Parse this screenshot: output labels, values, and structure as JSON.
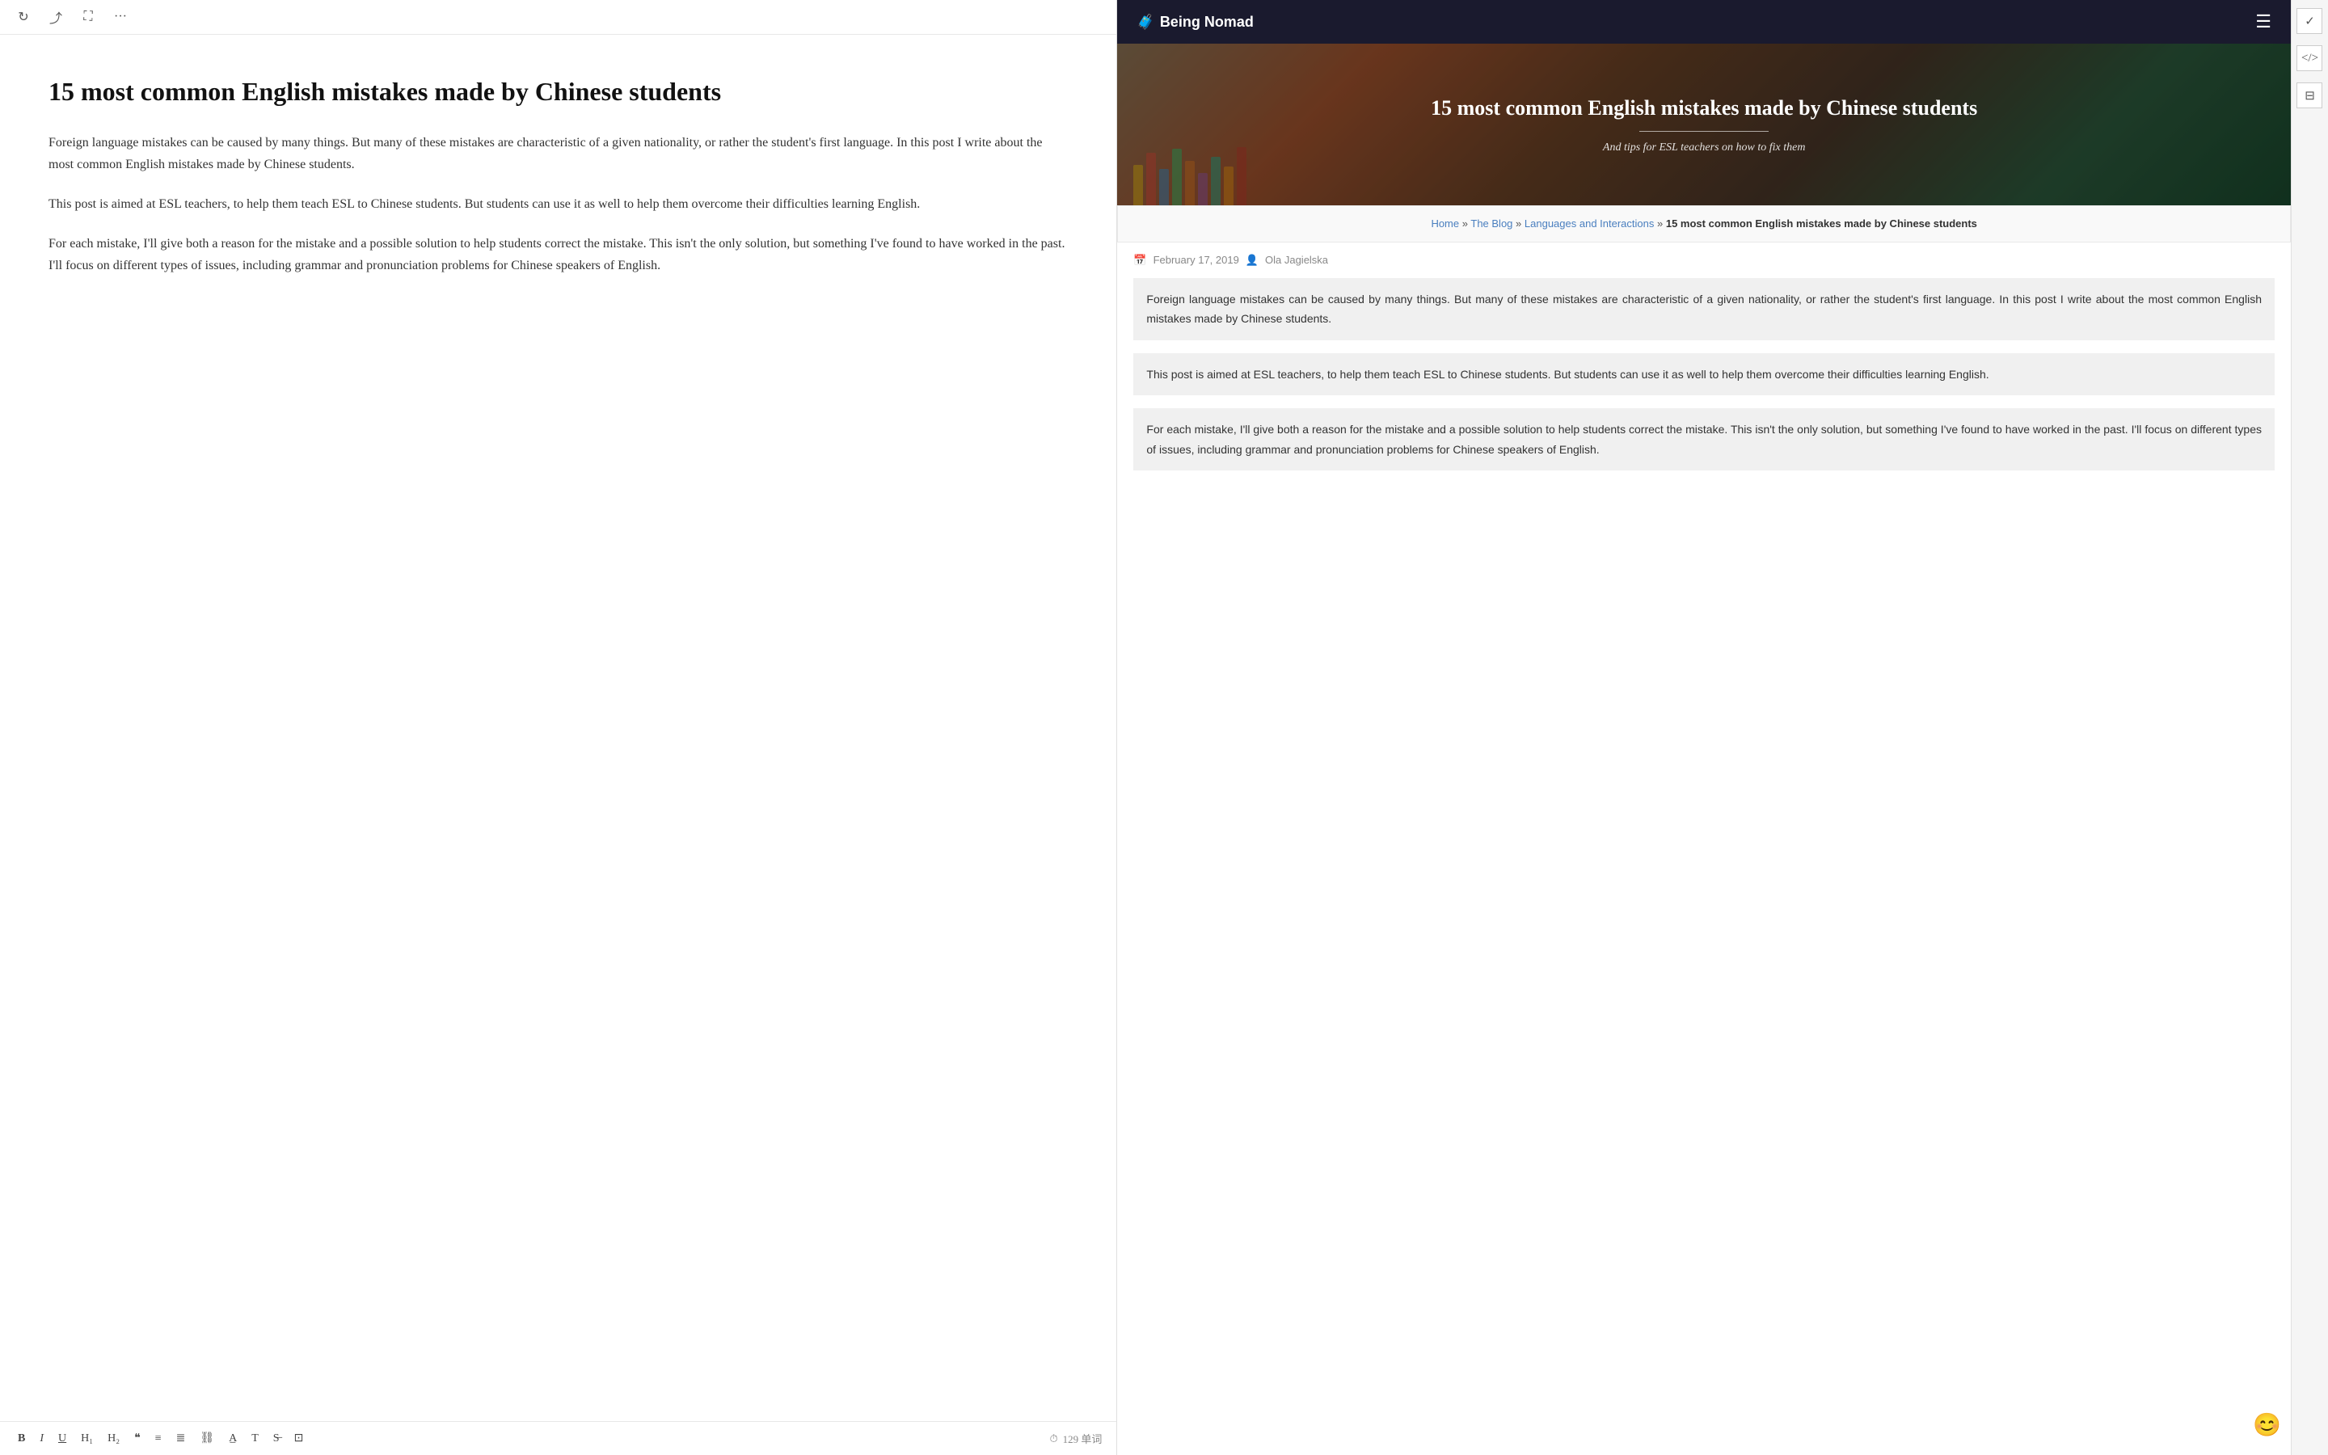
{
  "toolbar_top": {
    "refresh_label": "↻",
    "share_label": "⤴",
    "expand_label": "⛶",
    "more_label": "···"
  },
  "editor": {
    "title": "15 most common English mistakes made by Chinese students",
    "paragraphs": [
      "Foreign language mistakes can be caused by many things. But many of these mistakes are characteristic of a given nationality, or rather the student's first language. In this post I write about the most common English mistakes made by Chinese students.",
      "This post is aimed at ESL teachers, to help them teach ESL to Chinese students. But students can use it as well to help them overcome their difficulties learning English.",
      "For each mistake, I'll give both a reason for the mistake and a possible solution to help students correct the mistake. This isn't the only solution, but something I've found to have worked in the past. I'll focus on different types of issues, including grammar and pronunciation problems for Chinese speakers of English."
    ]
  },
  "toolbar_bottom": {
    "bold": "B",
    "italic": "I",
    "underline": "U",
    "h1": "H₁",
    "h2": "H₂",
    "quote": "❝",
    "list_ul": "≡",
    "list_ol": "≣",
    "link": "⛓",
    "underline2": "A̲",
    "font": "T",
    "strikethrough": "S̶",
    "image": "⊡",
    "word_count": "129 单词",
    "clock_icon": "⏱"
  },
  "sidebar_icons": {
    "check": "✓",
    "code": "</>",
    "stack": "⊟"
  },
  "browser": {
    "header": {
      "logo_text": "Being Nomad",
      "logo_icon": "🧳",
      "menu_icon": "☰"
    },
    "hero": {
      "title": "15 most common English mistakes made by Chinese students",
      "subtitle": "And tips for ESL teachers on how to fix them"
    },
    "breadcrumb": {
      "home": "Home",
      "separator1": "»",
      "blog": "The Blog",
      "separator2": "»",
      "category": "Languages and Interactions",
      "separator3": "»",
      "current": "15 most common English mistakes made by Chinese students"
    },
    "post_meta": {
      "date": "February 17, 2019",
      "author": "Ola Jagielska",
      "calendar_icon": "📅",
      "person_icon": "👤"
    },
    "article_paragraphs": [
      "Foreign language mistakes can be caused by many things. But many of these mistakes are characteristic of a given nationality, or rather the student's first language. In this post I write about the most common English mistakes made by Chinese students.",
      "This post is aimed at ESL teachers, to help them teach ESL to Chinese students. But students can use it as well to help them overcome their difficulties learning English.",
      "For each mistake, I'll give both a reason for the mistake and a possible solution to help students correct the mistake. This isn't the only solution, but something I've found to have worked in the past. I'll focus on different types of issues, including grammar and pronunciation problems for Chinese speakers of English."
    ]
  },
  "emoji_fab": "😊"
}
